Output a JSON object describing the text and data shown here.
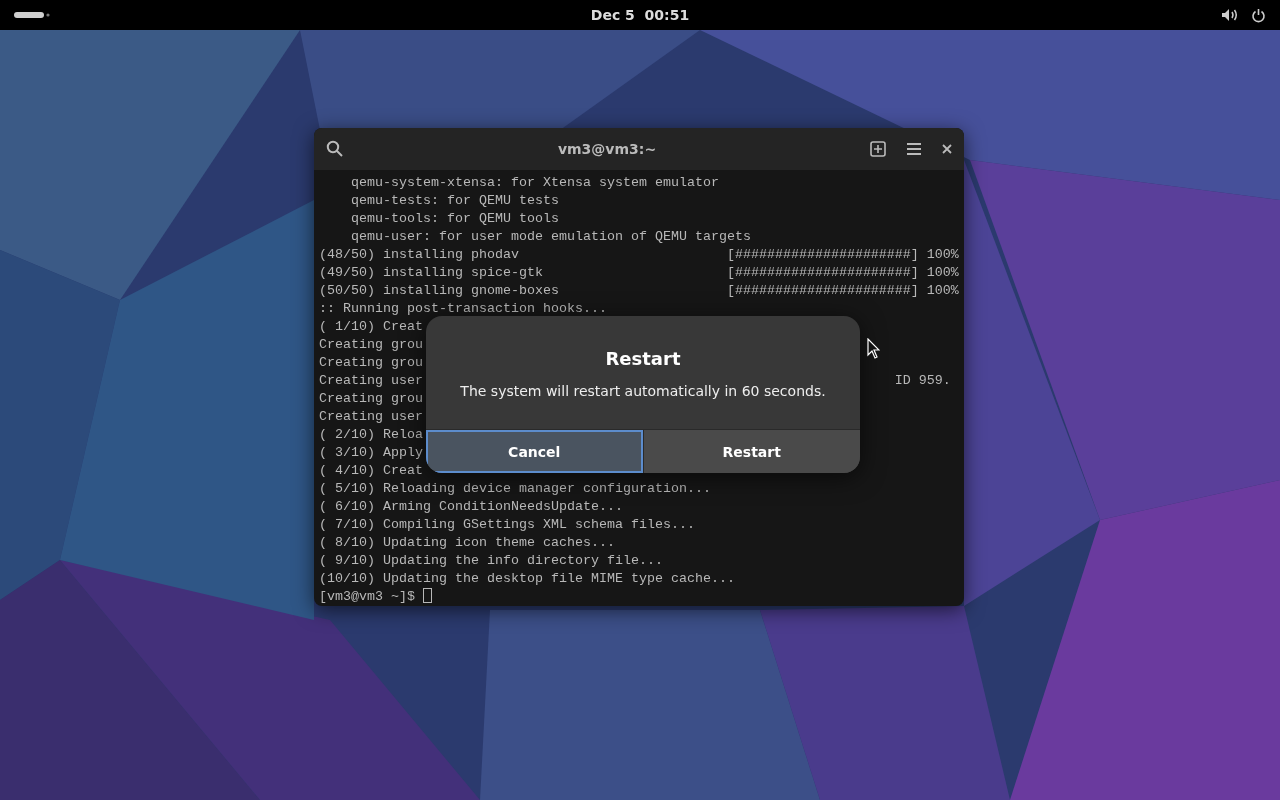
{
  "top_bar": {
    "clock": "Dec 5  00:51"
  },
  "terminal": {
    "title": "vm3@vm3:~",
    "lines": [
      {
        "text": "    qemu-system-xtensa: for Xtensa system emulator"
      },
      {
        "text": "    qemu-tests: for QEMU tests"
      },
      {
        "text": "    qemu-tools: for QEMU tools"
      },
      {
        "text": "    qemu-user: for user mode emulation of QEMU targets"
      },
      {
        "text": "(48/50) installing phodav",
        "right": "[######################] 100%"
      },
      {
        "text": "(49/50) installing spice-gtk",
        "right": "[######################] 100%"
      },
      {
        "text": "(50/50) installing gnome-boxes",
        "right": "[######################] 100%"
      },
      {
        "text": ":: Running post-transaction hooks..."
      },
      {
        "text": "( 1/10) Creat"
      },
      {
        "text": "Creating grou"
      },
      {
        "text": "Creating grou"
      },
      {
        "text": "Creating user",
        "right": "ID 959."
      },
      {
        "text": "Creating grou"
      },
      {
        "text": "Creating user"
      },
      {
        "text": "( 2/10) Reloa"
      },
      {
        "text": "( 3/10) Apply"
      },
      {
        "text": "( 4/10) Creat"
      },
      {
        "text": "( 5/10) Reloading device manager configuration..."
      },
      {
        "text": "( 6/10) Arming ConditionNeedsUpdate..."
      },
      {
        "text": "( 7/10) Compiling GSettings XML schema files..."
      },
      {
        "text": "( 8/10) Updating icon theme caches..."
      },
      {
        "text": "( 9/10) Updating the info directory file..."
      },
      {
        "text": "(10/10) Updating the desktop file MIME type cache..."
      }
    ],
    "prompt": "[vm3@vm3 ~]$"
  },
  "dialog": {
    "title": "Restart",
    "message": "The system will restart automatically in 60 seconds.",
    "buttons": [
      {
        "label": "Cancel",
        "focused": true
      },
      {
        "label": "Restart",
        "focused": false
      }
    ]
  }
}
